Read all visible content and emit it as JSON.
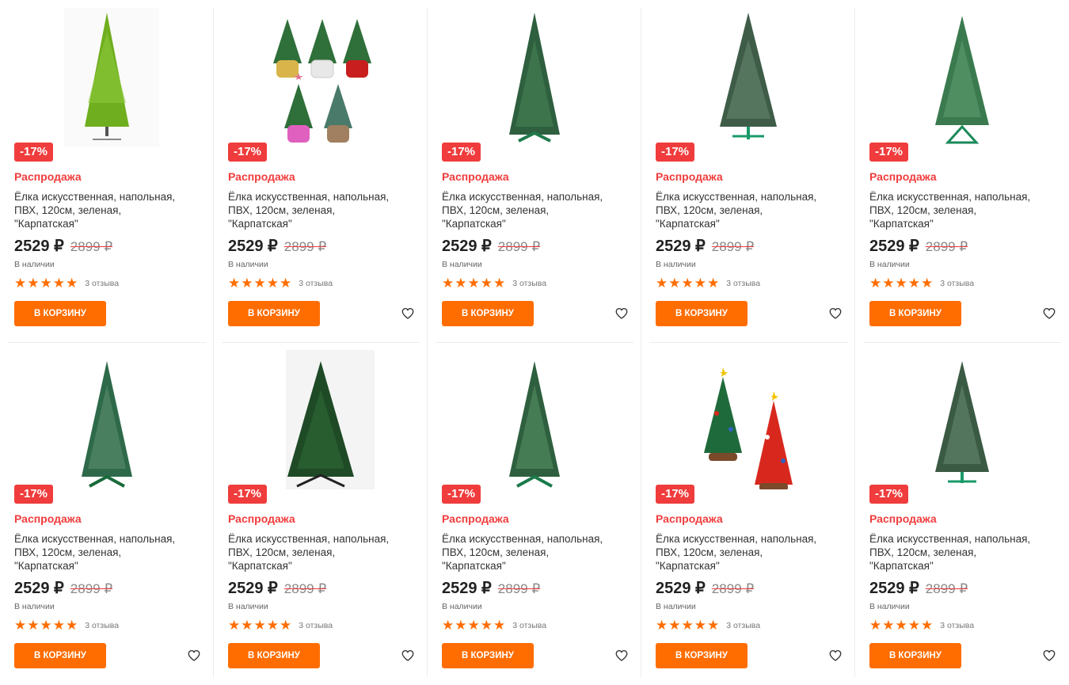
{
  "colors": {
    "accent": "#ff6d00",
    "sale": "#f03c3c"
  },
  "products": [
    {
      "image": "tree-1",
      "discount": "-17%",
      "sale_label": "Распродажа",
      "title": "Ёлка искусственная, напольная, ПВХ, 120см, зеленая, \"Карпатская\"",
      "price": "2529 ₽",
      "old_price": "2899 ₽",
      "stock": "В наличии",
      "stars": "★★★★★",
      "reviews": "3 отзыва",
      "cart_label": "В КОРЗИНУ",
      "heart": false
    },
    {
      "image": "mini-trees",
      "discount": "-17%",
      "sale_label": "Распродажа",
      "title": "Ёлка искусственная, напольная, ПВХ, 120см, зеленая, \"Карпатская\"",
      "price": "2529 ₽",
      "old_price": "2899 ₽",
      "stock": "В наличии",
      "stars": "★★★★★",
      "reviews": "3 отзыва",
      "cart_label": "В КОРЗИНУ",
      "heart": true
    },
    {
      "image": "tree-3",
      "discount": "-17%",
      "sale_label": "Распродажа",
      "title": "Ёлка искусственная, напольная, ПВХ, 120см, зеленая, \"Карпатская\"",
      "price": "2529 ₽",
      "old_price": "2899 ₽",
      "stock": "В наличии",
      "stars": "★★★★★",
      "reviews": "3 отзыва",
      "cart_label": "В КОРЗИНУ",
      "heart": true
    },
    {
      "image": "tree-4",
      "discount": "-17%",
      "sale_label": "Распродажа",
      "title": "Ёлка искусственная, напольная, ПВХ, 120см, зеленая, \"Карпатская\"",
      "price": "2529 ₽",
      "old_price": "2899 ₽",
      "stock": "В наличии",
      "stars": "★★★★★",
      "reviews": "3 отзыва",
      "cart_label": "В КОРЗИНУ",
      "heart": true
    },
    {
      "image": "tree-5",
      "discount": "-17%",
      "sale_label": "Распродажа",
      "title": "Ёлка искусственная, напольная, ПВХ, 120см, зеленая, \"Карпатская\"",
      "price": "2529 ₽",
      "old_price": "2899 ₽",
      "stock": "В наличии",
      "stars": "★★★★★",
      "reviews": "3 отзыва",
      "cart_label": "В КОРЗИНУ",
      "heart": true
    },
    {
      "image": "tree-6",
      "discount": "-17%",
      "sale_label": "Распродажа",
      "title": "Ёлка искусственная, напольная, ПВХ, 120см, зеленая, \"Карпатская\"",
      "price": "2529 ₽",
      "old_price": "2899 ₽",
      "stock": "В наличии",
      "stars": "★★★★★",
      "reviews": "3 отзыва",
      "cart_label": "В КОРЗИНУ",
      "heart": true
    },
    {
      "image": "tree-7",
      "discount": "-17%",
      "sale_label": "Распродажа",
      "title": "Ёлка искусственная, напольная, ПВХ, 120см, зеленая, \"Карпатская\"",
      "price": "2529 ₽",
      "old_price": "2899 ₽",
      "stock": "В наличии",
      "stars": "★★★★★",
      "reviews": "3 отзыва",
      "cart_label": "В КОРЗИНУ",
      "heart": true
    },
    {
      "image": "tree-8",
      "discount": "-17%",
      "sale_label": "Распродажа",
      "title": "Ёлка искусственная, напольная, ПВХ, 120см, зеленая, \"Карпатская\"",
      "price": "2529 ₽",
      "old_price": "2899 ₽",
      "stock": "В наличии",
      "stars": "★★★★★",
      "reviews": "3 отзыва",
      "cart_label": "В КОРЗИНУ",
      "heart": true
    },
    {
      "image": "wooden-trees",
      "discount": "-17%",
      "sale_label": "Распродажа",
      "title": "Ёлка искусственная, напольная, ПВХ, 120см, зеленая, \"Карпатская\"",
      "price": "2529 ₽",
      "old_price": "2899 ₽",
      "stock": "В наличии",
      "stars": "★★★★★",
      "reviews": "3 отзыва",
      "cart_label": "В КОРЗИНУ",
      "heart": true
    },
    {
      "image": "tree-10",
      "discount": "-17%",
      "sale_label": "Распродажа",
      "title": "Ёлка искусственная, напольная, ПВХ, 120см, зеленая, \"Карпатская\"",
      "price": "2529 ₽",
      "old_price": "2899 ₽",
      "stock": "В наличии",
      "stars": "★★★★★",
      "reviews": "3 отзыва",
      "cart_label": "В КОРЗИНУ",
      "heart": true
    }
  ]
}
